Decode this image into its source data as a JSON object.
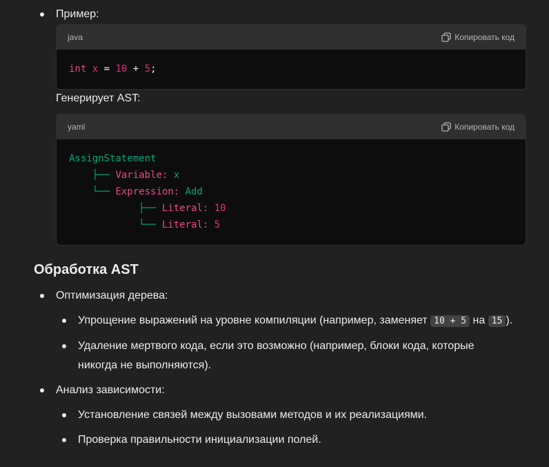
{
  "example_item": {
    "label": "Пример:"
  },
  "code1": {
    "language": "java",
    "copy_label": "Копировать код",
    "tokens": {
      "kw": "int",
      "var": "x",
      "eq": "=",
      "n1": "10",
      "plus": "+",
      "n2": "5",
      "semi": ";"
    }
  },
  "generates_label": "Генерирует AST:",
  "code2": {
    "language": "yaml",
    "copy_label": "Копировать код",
    "lines": [
      {
        "indent": "",
        "prefix": "",
        "key": "",
        "value": "AssignStatement"
      },
      {
        "indent": "    ",
        "prefix": "├── ",
        "key": "Variable:",
        "value": "x"
      },
      {
        "indent": "    ",
        "prefix": "└── ",
        "key": "Expression:",
        "value": "Add"
      },
      {
        "indent": "            ",
        "prefix": "├── ",
        "key": "Literal:",
        "value": "10"
      },
      {
        "indent": "            ",
        "prefix": "└── ",
        "key": "Literal:",
        "value": "5"
      }
    ]
  },
  "section": {
    "heading": "Обработка AST",
    "items": [
      {
        "label": "Оптимизация дерева:",
        "sub": [
          {
            "pre": "Упрощение выражений на уровне компиляции (например, заменяет ",
            "code1": "10 + 5",
            "mid": " на ",
            "code2": "15",
            "post": ")."
          },
          {
            "line1": "Удаление мертвого кода, если это возможно (например, блоки кода, которые",
            "line2": "никогда не выполняются)."
          }
        ]
      },
      {
        "label": "Анализ зависимости:",
        "sub": [
          {
            "text": "Установление связей между вызовами методов и их реализациями."
          },
          {
            "text": "Проверка правильности инициализации полей."
          }
        ]
      }
    ]
  }
}
